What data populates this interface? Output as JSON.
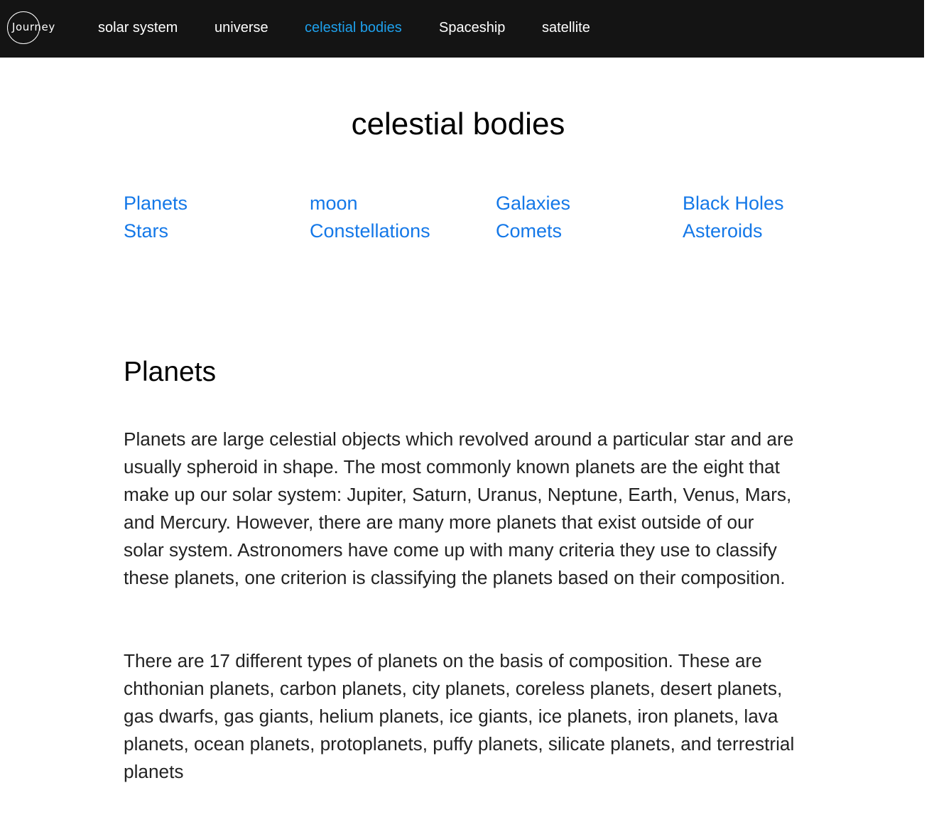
{
  "nav": {
    "logo_text": "Journey",
    "items": [
      {
        "label": "solar system",
        "active": false
      },
      {
        "label": "universe",
        "active": false
      },
      {
        "label": "celestial bodies",
        "active": true
      },
      {
        "label": "Spaceship",
        "active": false
      },
      {
        "label": "satellite",
        "active": false
      }
    ],
    "colors": {
      "background": "#141414",
      "text": "#ffffff",
      "active": "#1ea0ec"
    }
  },
  "page_title": "celestial bodies",
  "topics": [
    {
      "label": "Planets"
    },
    {
      "label": "moon"
    },
    {
      "label": "Galaxies"
    },
    {
      "label": "Black Holes"
    },
    {
      "label": "Stars"
    },
    {
      "label": "Constellations"
    },
    {
      "label": "Comets"
    },
    {
      "label": "Asteroids"
    }
  ],
  "section": {
    "heading": "Planets",
    "paragraphs": [
      "Planets are large celestial objects which revolved around a particular star and are usually spheroid in shape. The most commonly known planets are the eight that make up our solar system: Jupiter, Saturn, Uranus, Neptune, Earth, Venus, Mars, and Mercury. However, there are many more planets that exist outside of our solar system. Astronomers have come up with many criteria they use to classify these planets, one criterion is classifying the planets based on their composition.",
      "There are 17 different types of planets on the basis of composition. These are chthonian planets, carbon planets, city planets, coreless planets, desert planets, gas dwarfs, gas giants, helium planets, ice giants, ice planets, iron planets, lava planets, ocean planets, protoplanets, puffy planets, silicate planets, and terrestrial planets"
    ]
  },
  "colors": {
    "link": "#1478e8",
    "body_text": "#222222"
  }
}
